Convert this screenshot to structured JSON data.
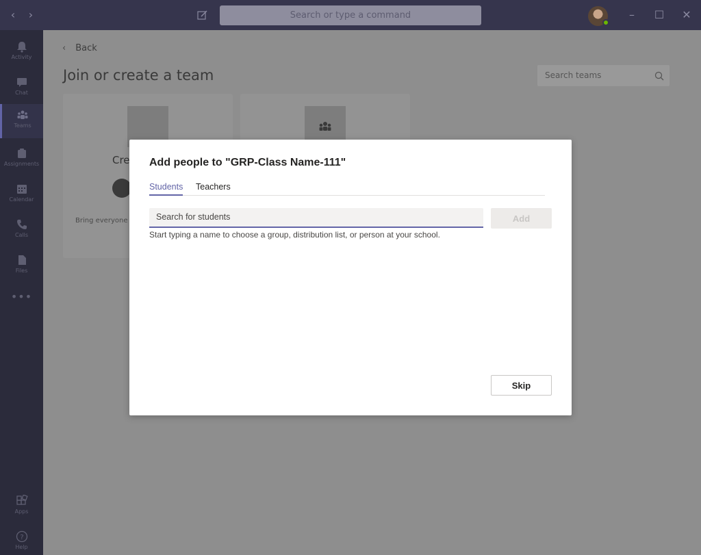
{
  "titlebar": {
    "search_placeholder": "Search or type a command",
    "back_icon": "chevron-left-icon",
    "forward_icon": "chevron-right-icon"
  },
  "rail": {
    "items": [
      {
        "label": "Activity",
        "icon": "bell-icon"
      },
      {
        "label": "Chat",
        "icon": "chat-icon"
      },
      {
        "label": "Teams",
        "icon": "teams-icon",
        "active": true
      },
      {
        "label": "Assignments",
        "icon": "assignments-icon"
      },
      {
        "label": "Calendar",
        "icon": "calendar-icon"
      },
      {
        "label": "Calls",
        "icon": "phone-icon"
      },
      {
        "label": "Files",
        "icon": "file-icon"
      },
      {
        "label": "Apps",
        "icon": "apps-icon"
      },
      {
        "label": "Help",
        "icon": "help-icon"
      }
    ],
    "more": "•••"
  },
  "page": {
    "back_label": "Back",
    "title": "Join or create a team",
    "search_teams_placeholder": "Search teams",
    "card1_text": "Cre",
    "card1_sub": "Bring everyone"
  },
  "modal": {
    "title": "Add people to \"GRP-Class Name-111\"",
    "tabs": [
      "Students",
      "Teachers"
    ],
    "active_tab": "Students",
    "search_placeholder": "Search for students",
    "add_label": "Add",
    "hint": "Start typing a name to choose a group, distribution list, or person at your school.",
    "skip_label": "Skip"
  },
  "colors": {
    "accent": "#6264a7",
    "titlebar": "#36354d",
    "rail": "#2b2b3b"
  }
}
